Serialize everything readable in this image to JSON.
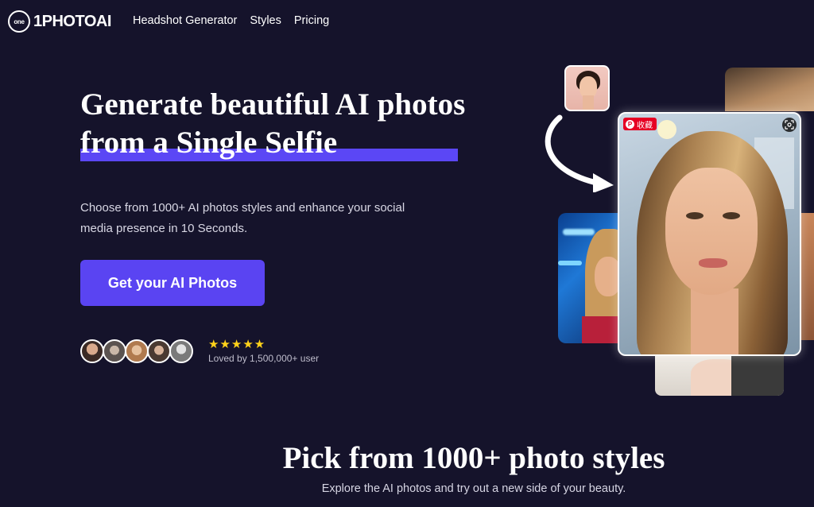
{
  "nav": {
    "logo_mark": "one",
    "logo_text": "1PHOTOAI",
    "links": [
      "Headshot Generator",
      "Styles",
      "Pricing"
    ]
  },
  "hero": {
    "title_line1": "Generate beautiful AI photos",
    "title_line2": "from a Single Selfie",
    "subtitle": "Choose from 1000+ AI photos styles and enhance your social media presence in 10 Seconds.",
    "cta_label": "Get your AI Photos",
    "rating_stars": "★★★★★",
    "rating": 5,
    "social_proof": "Loved by 1,500,000+ user"
  },
  "overlay": {
    "pin_label": "收藏"
  },
  "styles_section": {
    "title": "Pick from 1000+ photo styles",
    "subtitle": "Explore the AI photos and try out a new side of your beauty."
  },
  "colors": {
    "background": "#15132b",
    "accent": "#5a44f2",
    "star": "#ffd21a",
    "pinterest": "#e60023"
  },
  "icons": [
    "logo-icon",
    "star-icon",
    "pinterest-icon",
    "visual-search-icon",
    "curved-arrow-icon"
  ]
}
